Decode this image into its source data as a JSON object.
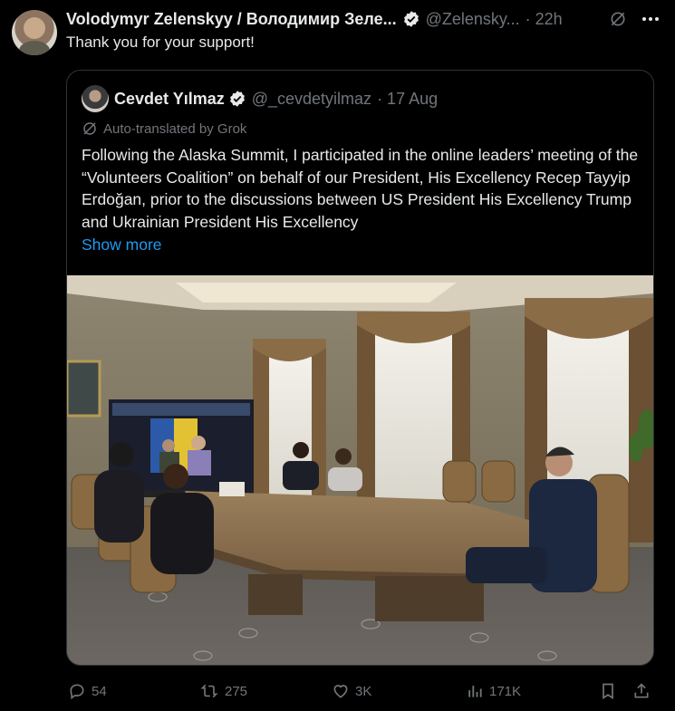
{
  "tweet": {
    "author_name": "Volodymyr Zelenskyy / Володимир Зеле...",
    "author_handle": "@Zelensky...",
    "time": "· 22h",
    "text": "Thank you for your support!"
  },
  "quote": {
    "author_name": "Cevdet Yılmaz",
    "author_handle": "@_cevdetyilmaz",
    "date": "· 17 Aug",
    "translation_note": "Auto-translated by Grok",
    "text": "Following the Alaska Summit, I participated in the online leaders’ meeting of the “Volunteers Coalition” on behalf of our President, His Excellency Recep Tayyip Erdoğan, prior to the discussions between US President His Excellency Trump and Ukrainian President His Excellency",
    "show_more": "Show more"
  },
  "actions": {
    "replies": "54",
    "reposts": "275",
    "likes": "3K",
    "views": "171K"
  },
  "icons": {
    "verified": "verified-badge-icon",
    "grok": "grok-icon",
    "more": "more-icon",
    "reply": "reply-icon",
    "repost": "repost-icon",
    "like": "heart-icon",
    "views": "views-icon",
    "bookmark": "bookmark-icon",
    "share": "share-icon"
  },
  "colors": {
    "background": "#000000",
    "text": "#e7e9ea",
    "muted": "#71767b",
    "link": "#1d9bf0",
    "border": "#2f3336"
  }
}
